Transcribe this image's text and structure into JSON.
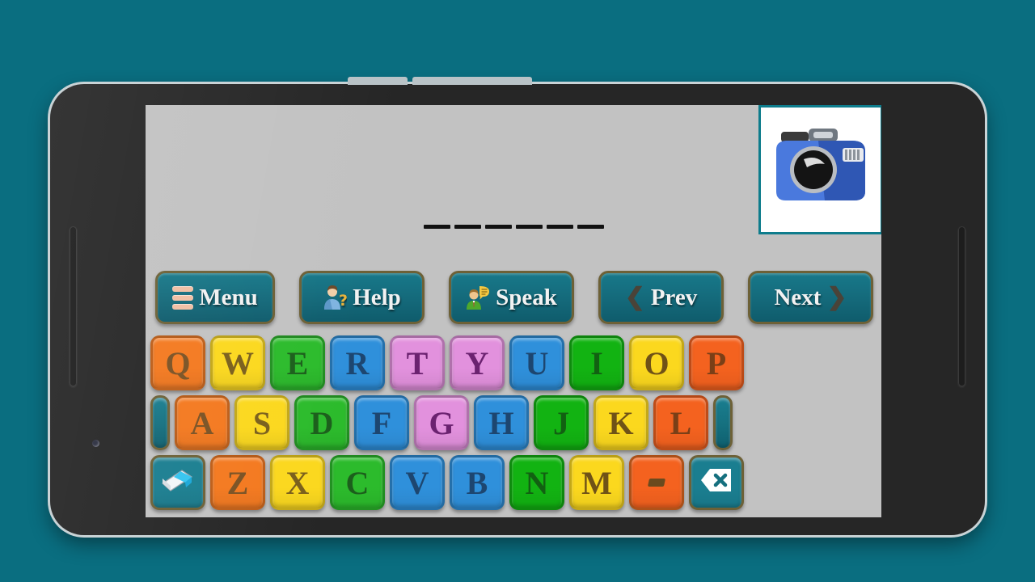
{
  "app": {
    "background_color": "#0a6e80",
    "screen_background": "#c2c2c2",
    "accent_color": "#15707f",
    "border_color": "#6d6137"
  },
  "picture": {
    "name": "camera-illustration",
    "alt": "blue camera",
    "body_color": "#3f6fd4",
    "body_color_dark": "#2f56b0",
    "lens_color": "#141414",
    "border_color": "#0e7c8c",
    "background": "#ffffff"
  },
  "word": {
    "answer_length": 6,
    "blanks": [
      "",
      "",
      "",
      "",
      "",
      ""
    ],
    "dash_color": "#111111"
  },
  "toolbar": {
    "buttons": [
      {
        "id": "menu",
        "label": "Menu",
        "icon": "hamburger-icon",
        "icon_side": "left"
      },
      {
        "id": "help",
        "label": "Help",
        "icon": "person-question-icon",
        "icon_side": "left"
      },
      {
        "id": "speak",
        "label": "Speak",
        "icon": "person-speech-icon",
        "icon_side": "left"
      },
      {
        "id": "prev",
        "label": "Prev",
        "icon": "chevron-left-icon",
        "icon_side": "left"
      },
      {
        "id": "next",
        "label": "Next",
        "icon": "chevron-right-icon",
        "icon_side": "right"
      }
    ]
  },
  "keyboard": {
    "rows": [
      [
        {
          "key": "Q",
          "bg": "#f4791f",
          "fg": "#7a5224",
          "type": "letter"
        },
        {
          "key": "W",
          "bg": "#fbd81e",
          "fg": "#7a5f1c",
          "type": "letter"
        },
        {
          "key": "E",
          "bg": "#2cbb2c",
          "fg": "#1c5f1c",
          "type": "letter"
        },
        {
          "key": "R",
          "bg": "#2f90db",
          "fg": "#1d4670",
          "type": "letter"
        },
        {
          "key": "T",
          "bg": "#e291dd",
          "fg": "#6b2270",
          "type": "letter"
        },
        {
          "key": "Y",
          "bg": "#e291dd",
          "fg": "#6b2270",
          "type": "letter"
        },
        {
          "key": "U",
          "bg": "#2f90db",
          "fg": "#1d4670",
          "type": "letter"
        },
        {
          "key": "I",
          "bg": "#12b312",
          "fg": "#126012",
          "type": "letter"
        },
        {
          "key": "O",
          "bg": "#fbd81e",
          "fg": "#6f5217",
          "type": "letter"
        },
        {
          "key": "P",
          "bg": "#f4621f",
          "fg": "#7a3f17",
          "type": "letter"
        }
      ],
      [
        {
          "key": "",
          "bg": "#1a7e90",
          "fg": "#1a7e90",
          "type": "spacer-half"
        },
        {
          "key": "A",
          "bg": "#f4791f",
          "fg": "#7a5224",
          "type": "letter"
        },
        {
          "key": "S",
          "bg": "#fbd81e",
          "fg": "#7a5f1c",
          "type": "letter"
        },
        {
          "key": "D",
          "bg": "#2cbb2c",
          "fg": "#1c5f1c",
          "type": "letter"
        },
        {
          "key": "F",
          "bg": "#2f90db",
          "fg": "#1d4670",
          "type": "letter"
        },
        {
          "key": "G",
          "bg": "#e291dd",
          "fg": "#6b2270",
          "type": "letter"
        },
        {
          "key": "H",
          "bg": "#2f90db",
          "fg": "#1d4670",
          "type": "letter"
        },
        {
          "key": "J",
          "bg": "#12b312",
          "fg": "#126012",
          "type": "letter"
        },
        {
          "key": "K",
          "bg": "#fbd81e",
          "fg": "#6f5217",
          "type": "letter"
        },
        {
          "key": "L",
          "bg": "#f4621f",
          "fg": "#7a3f17",
          "type": "letter"
        },
        {
          "key": "",
          "bg": "#1a7e90",
          "fg": "#1a7e90",
          "type": "spacer-half"
        }
      ],
      [
        {
          "key": "",
          "bg": "#1a7e90",
          "fg": "#ffffff",
          "type": "eraser",
          "icon": "eraser-icon"
        },
        {
          "key": "Z",
          "bg": "#f4791f",
          "fg": "#7a5224",
          "type": "letter"
        },
        {
          "key": "X",
          "bg": "#fbd81e",
          "fg": "#7a5f1c",
          "type": "letter"
        },
        {
          "key": "C",
          "bg": "#2cbb2c",
          "fg": "#1c5f1c",
          "type": "letter"
        },
        {
          "key": "V",
          "bg": "#2f90db",
          "fg": "#1d4670",
          "type": "letter"
        },
        {
          "key": "B",
          "bg": "#2f90db",
          "fg": "#1d4670",
          "type": "letter"
        },
        {
          "key": "N",
          "bg": "#12b312",
          "fg": "#126012",
          "type": "letter"
        },
        {
          "key": "M",
          "bg": "#fbd81e",
          "fg": "#6f5217",
          "type": "letter"
        },
        {
          "key": "-",
          "bg": "#f4621f",
          "fg": "#6a4a1e",
          "type": "dash"
        },
        {
          "key": "",
          "bg": "#1a7e90",
          "fg": "#15707f",
          "type": "backspace",
          "icon": "backspace-icon"
        }
      ]
    ]
  },
  "device": {
    "frame_color": "#262626",
    "rim_color": "#c9d3d6",
    "top_buttons": 2,
    "side_grooves": 2,
    "front_camera": "front-camera-dot"
  }
}
